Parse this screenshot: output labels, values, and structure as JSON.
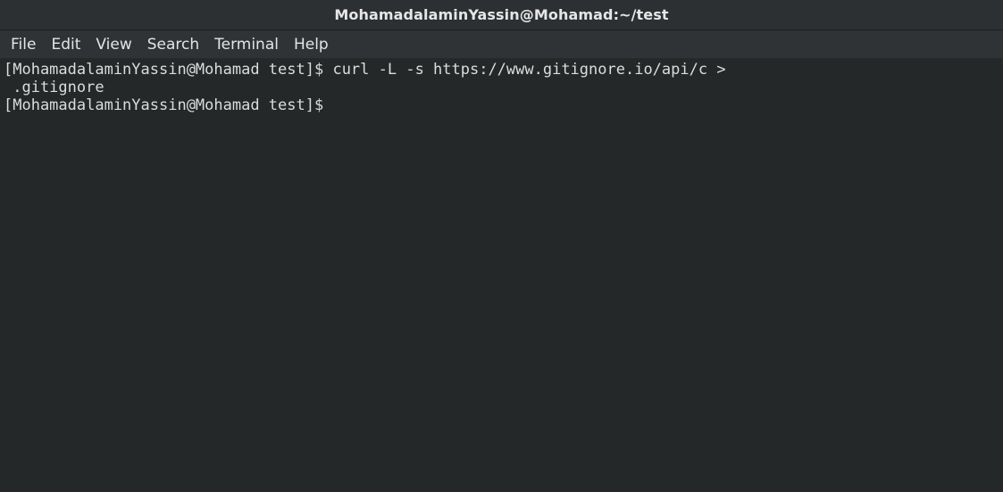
{
  "window": {
    "title": "MohamadalaminYassin@Mohamad:~/test"
  },
  "menu": {
    "items": [
      {
        "label": "File"
      },
      {
        "label": "Edit"
      },
      {
        "label": "View"
      },
      {
        "label": "Search"
      },
      {
        "label": "Terminal"
      },
      {
        "label": "Help"
      }
    ]
  },
  "terminal": {
    "lines": [
      "[MohamadalaminYassin@Mohamad test]$ curl -L -s https://www.gitignore.io/api/c >",
      " .gitignore",
      "[MohamadalaminYassin@Mohamad test]$ "
    ]
  },
  "colors": {
    "background": "#242828",
    "titlebar": "#2d3032",
    "menubar": "#2f3335",
    "text": "#dcdcdc"
  }
}
